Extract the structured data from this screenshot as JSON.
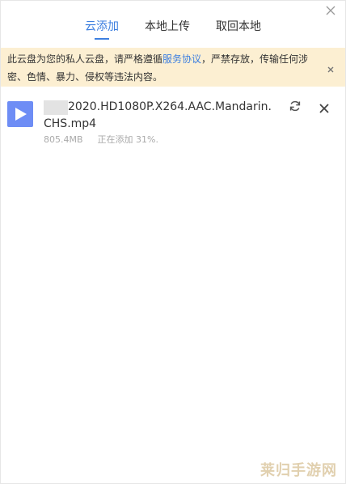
{
  "tabs": [
    {
      "label": "云添加",
      "active": true
    },
    {
      "label": "本地上传",
      "active": false
    },
    {
      "label": "取回本地",
      "active": false
    }
  ],
  "notice": {
    "text_before": "此云盘为您的私人云盘，请严格遵循",
    "link": "服务协议",
    "text_after": "，严禁存放，传输任何涉密、色情、暴力、侵权等违法内容。"
  },
  "task": {
    "filename": "2020.HD1080P.X264.AAC.Mandarin.CHS.mp4",
    "size": "805.4MB",
    "status": "正在添加 31%."
  },
  "watermark": "莱归手游网",
  "colors": {
    "accent": "#3d7fe0",
    "notice_bg": "#fcefd2",
    "file_icon": "#6e8df5"
  },
  "icons": {
    "close": "close-icon",
    "play": "play-icon",
    "retry": "refresh-icon"
  }
}
